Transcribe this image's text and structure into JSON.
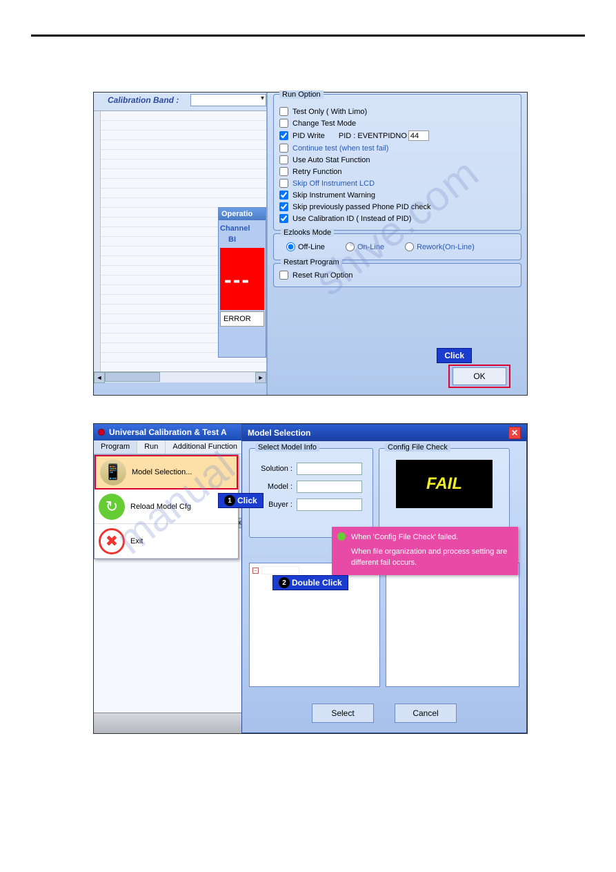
{
  "hr": "",
  "screenshot1": {
    "calibration_band_label": "Calibration Band :",
    "op_panel_title": "Operatio",
    "op_channel": "Channel",
    "op_bi": "BI",
    "op_dashes": "---",
    "op_error": "ERROR",
    "run_option_title": "Run Option",
    "checks": {
      "test_only": "Test Only ( With Limo)",
      "change_test": "Change Test Mode",
      "pid_write": "PID Write",
      "pid_label": "PID :  EVENTPIDNO",
      "pid_value": "44",
      "continue_test": "Continue test (when test fail)",
      "auto_stat": "Use Auto Stat Function",
      "retry": "Retry Function",
      "skip_lcd": "Skip Off Instrument LCD",
      "skip_warn": "Skip Instrument Warning",
      "skip_pid": "Skip previously passed Phone PID check",
      "use_calib": "Use Calibration ID ( Instead of PID)"
    },
    "ezlooks_title": "Ezlooks Mode",
    "ezlooks": {
      "offline": "Off-Line",
      "online": "On-Line",
      "rework": "Rework(On-Line)"
    },
    "restart_title": "Restart Program",
    "restart_reset": "Reset Run Option",
    "click_label": "Click",
    "ok_button": "OK",
    "watermark": "shive.com"
  },
  "screenshot2": {
    "title": "Universal Calibration & Test A",
    "menu": {
      "program": "Program",
      "run": "Run",
      "additional": "Additional Function"
    },
    "dropdown": {
      "model_sel": "Model Selection...",
      "reload": "Reload Model Cfg",
      "exit": "Exit"
    },
    "click1": "Click",
    "dialog_title": "Model Selection",
    "select_model_legend": "Select Model Info",
    "fields": {
      "solution": "Solution :",
      "model": "Model :",
      "buyer": "Buyer :"
    },
    "config_legend": "Config File Check",
    "fail": "FAIL",
    "pink_line1": "When 'Config File Check' failed.",
    "pink_line2": "When file organization and process setting are different fail occurs.",
    "dblclick": "Double Click",
    "select_btn": "Select",
    "cancel_btn": "Cancel",
    "watermark": "manual",
    "xss": "xss",
    "tree_minus": "−"
  }
}
